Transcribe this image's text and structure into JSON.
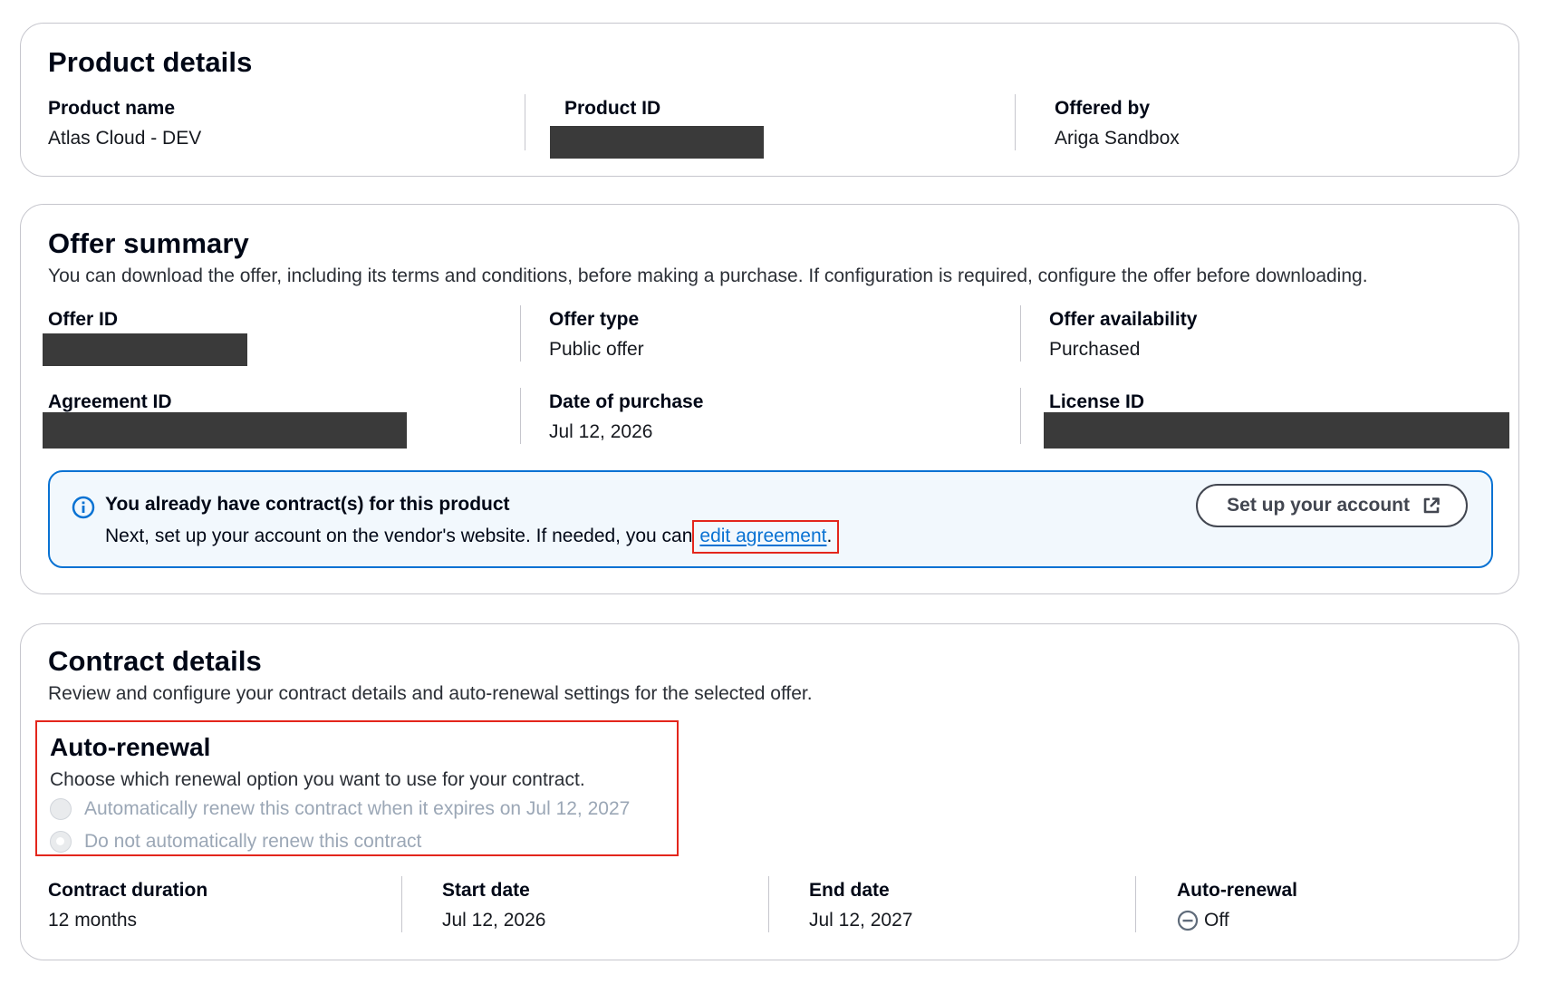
{
  "product_details": {
    "title": "Product details",
    "fields": {
      "product_name": {
        "label": "Product name",
        "value": "Atlas Cloud - DEV"
      },
      "product_id": {
        "label": "Product ID"
      },
      "offered_by": {
        "label": "Offered by",
        "value": "Ariga Sandbox"
      }
    }
  },
  "offer_summary": {
    "title": "Offer summary",
    "description": "You can download the offer, including its terms and conditions, before making a purchase. If configuration is required, configure the offer before downloading.",
    "fields": {
      "offer_id": {
        "label": "Offer ID"
      },
      "offer_type": {
        "label": "Offer type",
        "value": "Public offer"
      },
      "offer_availability": {
        "label": "Offer availability",
        "value": "Purchased"
      },
      "agreement_id": {
        "label": "Agreement ID"
      },
      "date_of_purchase": {
        "label": "Date of purchase",
        "value": "Jul 12, 2026"
      },
      "license_id": {
        "label": "License ID"
      }
    },
    "alert": {
      "icon": "info-icon",
      "title": "You already have contract(s) for this product",
      "body_prefix": "Next, set up your account on the vendor's website. If needed, you can",
      "link_label": "edit agreement",
      "body_suffix": ".",
      "button_label": "Set up your account",
      "button_icon": "external-link-icon",
      "accent_color": "#0972d3"
    }
  },
  "contract_details": {
    "title": "Contract details",
    "description": "Review and configure your contract details and auto-renewal settings for the selected offer.",
    "auto_renewal": {
      "title": "Auto-renewal",
      "description": "Choose which renewal option you want to use for your contract.",
      "options": [
        {
          "label": "Automatically renew this contract when it expires on Jul 12, 2027",
          "selected": false,
          "disabled": true
        },
        {
          "label": "Do not automatically renew this contract",
          "selected": true,
          "disabled": true
        }
      ]
    },
    "fields": {
      "contract_duration": {
        "label": "Contract duration",
        "value": "12 months"
      },
      "start_date": {
        "label": "Start date",
        "value": "Jul 12, 2026"
      },
      "end_date": {
        "label": "End date",
        "value": "Jul 12, 2027"
      },
      "auto_renewal": {
        "label": "Auto-renewal",
        "value": "Off",
        "icon": "minus-circle-icon"
      }
    }
  }
}
